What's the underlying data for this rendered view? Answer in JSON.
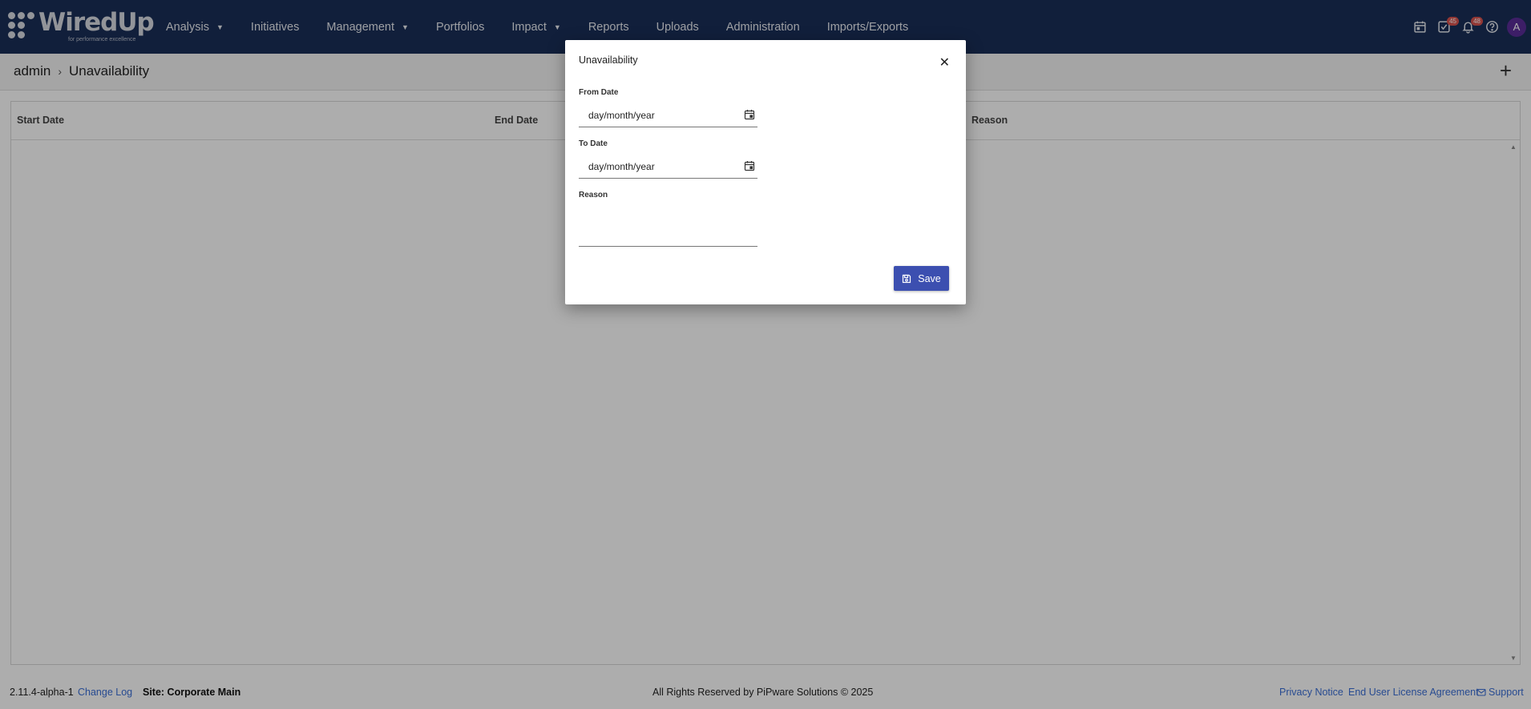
{
  "app": {
    "logo_text": "WiredUp",
    "logo_tagline": "for performance excellence"
  },
  "nav": {
    "items": [
      {
        "label": "Analysis",
        "has_dropdown": true
      },
      {
        "label": "Initiatives",
        "has_dropdown": false
      },
      {
        "label": "Management",
        "has_dropdown": true
      },
      {
        "label": "Portfolios",
        "has_dropdown": false
      },
      {
        "label": "Impact",
        "has_dropdown": true
      },
      {
        "label": "Reports",
        "has_dropdown": false
      },
      {
        "label": "Uploads",
        "has_dropdown": false
      },
      {
        "label": "Administration",
        "has_dropdown": false
      },
      {
        "label": "Imports/Exports",
        "has_dropdown": false
      }
    ],
    "dropdown_glyph": "▼",
    "icons": {
      "calendar": "calendar-icon",
      "tasks": "tasks-check-icon",
      "tasks_badge": "45",
      "notifications": "bell-icon",
      "notifications_badge": "48",
      "help": "help-icon",
      "avatar_initial": "A"
    },
    "colors": {
      "background": "#1a2e57",
      "badge": "#d9534f",
      "avatar": "#5a2d99"
    }
  },
  "breadcrumb": {
    "root": "admin",
    "separator": "›",
    "current": "Unavailability"
  },
  "actions": {
    "add_glyph": "+"
  },
  "table": {
    "columns": [
      "Start Date",
      "End Date",
      "Reason"
    ],
    "rows": []
  },
  "modal": {
    "title": "Unavailability",
    "close_glyph": "✕",
    "from_label": "From Date",
    "from_placeholder": "day/month/year",
    "to_label": "To Date",
    "to_placeholder": "day/month/year",
    "reason_label": "Reason",
    "reason_value": "",
    "save_label": "Save",
    "save_color": "#3c4fb0"
  },
  "footer": {
    "version": "2.11.4-alpha-1",
    "changelog": "Change Log",
    "site": "Site: Corporate Main",
    "copyright": "All Rights Reserved by PiPware Solutions © 2025",
    "privacy": "Privacy Notice",
    "eula": "End User License Agreement",
    "support": "Support"
  }
}
